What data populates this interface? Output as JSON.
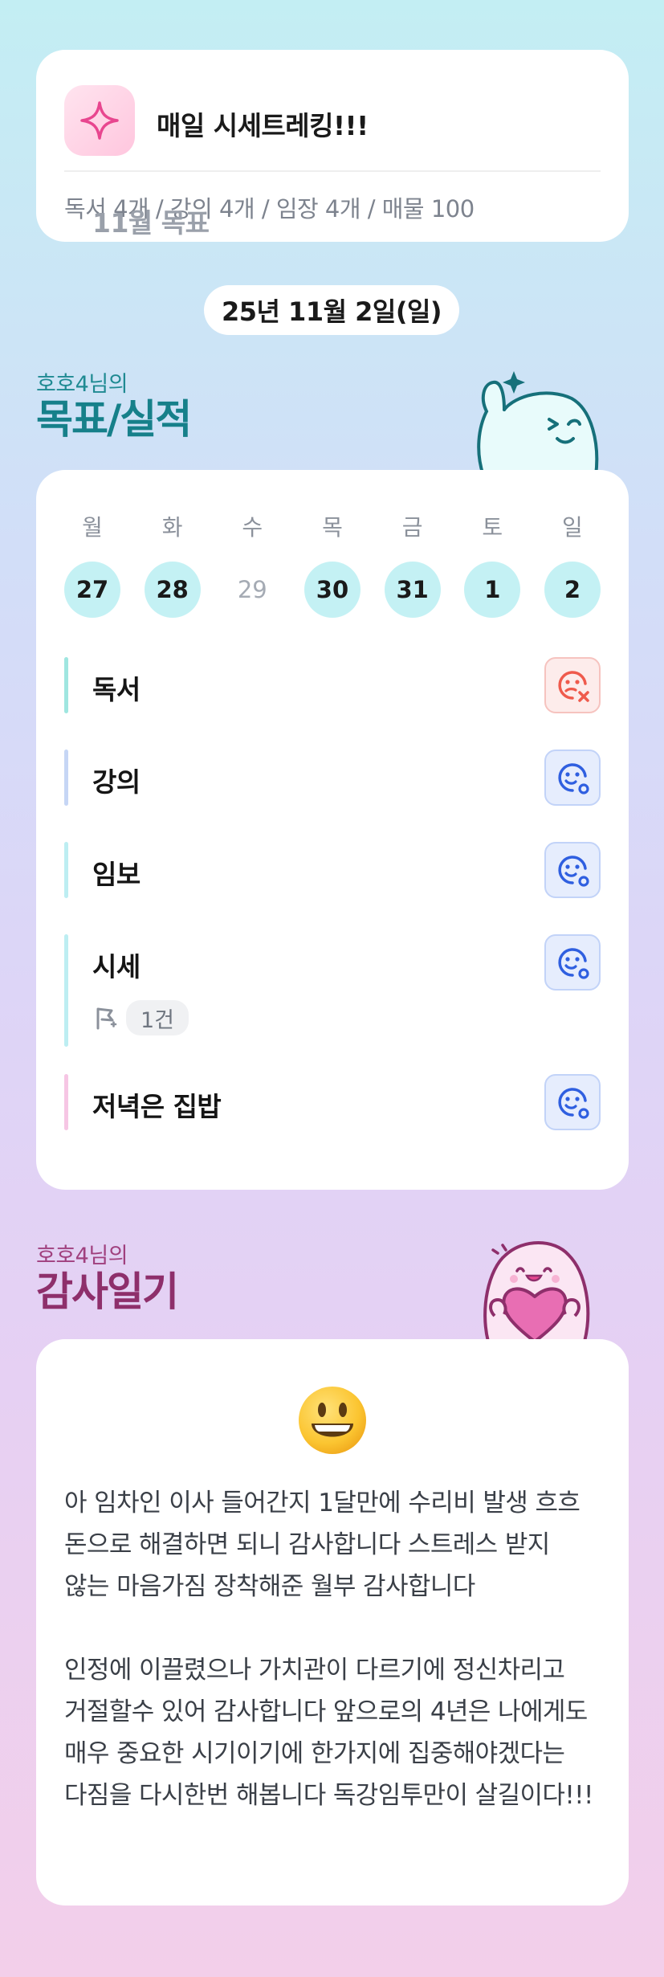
{
  "header": {
    "title": "매일 시세트레킹!!!",
    "icon": "sparkle-icon",
    "goal_label": "11월 목표",
    "goal_text": "독서 4개 / 강의 4개 / 임장 4개 / 매물 100"
  },
  "date": "25년 11월 2일(일)",
  "goals_section": {
    "owner": "호호4님의",
    "title": "목표/실적",
    "weekdays": [
      "월",
      "화",
      "수",
      "목",
      "금",
      "토",
      "일"
    ],
    "dates": [
      {
        "day": "27",
        "done": true
      },
      {
        "day": "28",
        "done": true
      },
      {
        "day": "29",
        "done": false
      },
      {
        "day": "30",
        "done": true
      },
      {
        "day": "31",
        "done": true
      },
      {
        "day": "1",
        "done": true
      },
      {
        "day": "2",
        "done": true
      }
    ],
    "items": [
      {
        "label": "독서",
        "status": "fail",
        "bar_color": "#9fe6e0"
      },
      {
        "label": "강의",
        "status": "ok",
        "bar_color": "#c6d6f5"
      },
      {
        "label": "임보",
        "status": "ok",
        "bar_color": "#bdeef2"
      },
      {
        "label": "시세",
        "status": "ok",
        "bar_color": "#bdeef2",
        "sub_count": "1건"
      },
      {
        "label": "저녁은 집밥",
        "status": "ok",
        "bar_color": "#f6c6e4"
      }
    ]
  },
  "diary_section": {
    "owner": "호호4님의",
    "title": "감사일기",
    "emoji": "grinning-face-icon",
    "text": "아 임차인 이사 들어간지 1달만에 수리비 발생 흐흐 돈으로 해결하면 되니 감사합니다 스트레스 받지 않는 마음가짐 장착해준 월부 감사합니다\n\n인정에 이끌렸으나 가치관이 다르기에 정신차리고 거절할수 있어 감사합니다 앞으로의 4년은 나에게도 매우 중요한 시기이기에 한가지에 집중해야겠다는 다짐을 다시한번 해봅니다 독강임투만이 살길이다!!!"
  },
  "colors": {
    "accent_teal": "#16808a",
    "accent_plum": "#8e2f6b",
    "day_done": "#c4f1f4",
    "fail_red": "#ef5a4c",
    "ok_blue": "#2f5fe0"
  }
}
